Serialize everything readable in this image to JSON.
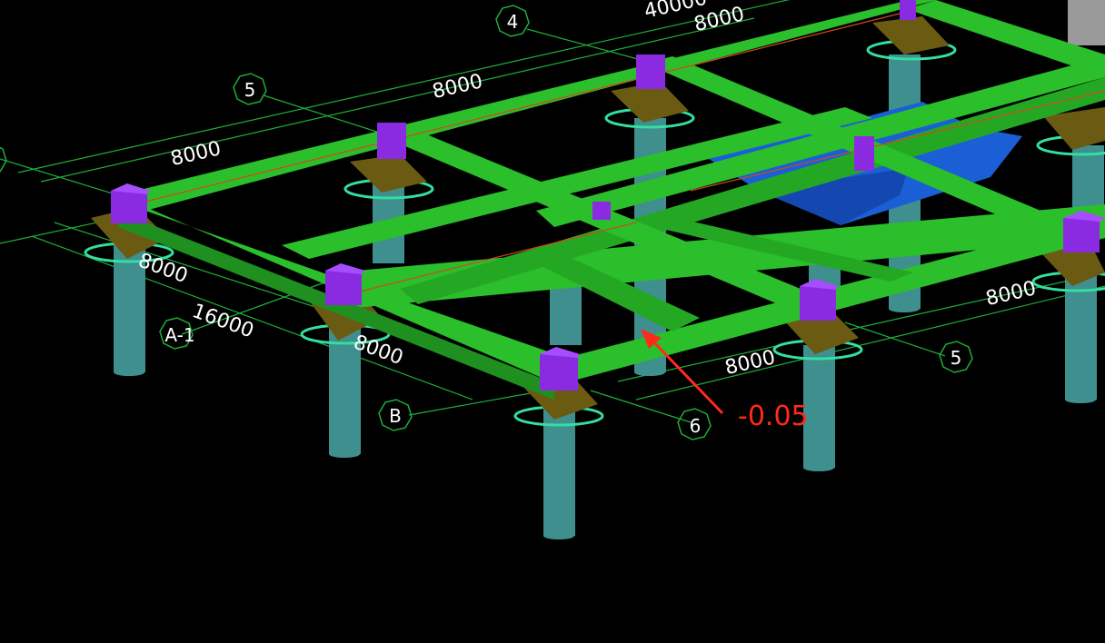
{
  "colors": {
    "background": "#000000",
    "beam": "#2bbf2b",
    "beam_dark": "#1f8f1f",
    "column": "#8a2be2",
    "pile_cap": "#6b5a12",
    "pile_cap_edge": "#33e0a0",
    "pile": "#3f8f8f",
    "slab": "#1a5fd6",
    "grid_line": "#1fae3a",
    "dim_text": "#ffffff",
    "annotation": "#ff2a1a"
  },
  "axis_labels": {
    "ax4": "4",
    "ax5_top": "5",
    "ax5_right": "5",
    "ax6": "6",
    "axB": "B",
    "axA1": "A-1"
  },
  "dimensions": {
    "top_40000": "40000",
    "top_8000_a": "8000",
    "top_8000_b": "8000",
    "top_8000_c": "8000",
    "left_8000": "8000",
    "left_16000": "16000",
    "left_8000_b": "8000",
    "bottom_8000": "8000",
    "right_8000": "8000"
  },
  "annotation": {
    "elevation": "-0.05",
    "icon": "red-arrow-icon"
  }
}
